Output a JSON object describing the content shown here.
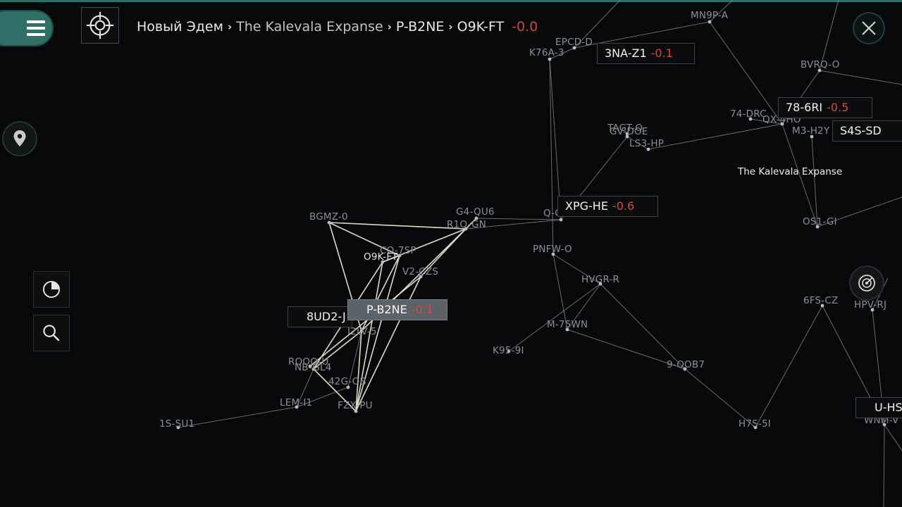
{
  "header": {
    "menu_icon": "hamburger-menu-icon",
    "target_icon": "crosshair-target-icon",
    "breadcrumb": [
      {
        "label": "Новый Эдем"
      },
      {
        "label": "The Kalevala Expanse"
      },
      {
        "label": "P-B2NE"
      },
      {
        "label": "O9K-FT"
      }
    ],
    "security": "-0.0",
    "close_icon": "close-icon"
  },
  "side_controls": {
    "pin_icon": "location-pin-icon",
    "stats_icon": "pie-chart-icon",
    "search_icon": "search-icon",
    "radar_icon": "radar-icon"
  },
  "region_label": "The Kalevala Expanse",
  "tags": [
    {
      "id": "3na",
      "name": "3NA-Z1",
      "sec": "-0.1"
    },
    {
      "id": "78",
      "name": "78-6RI",
      "sec": "-0.5"
    },
    {
      "id": "s4s",
      "name": "S4S-SD",
      "sec": ""
    },
    {
      "id": "xpg",
      "name": "XPG-HE",
      "sec": "-0.6"
    },
    {
      "id": "8ud",
      "name": "8UD2-J",
      "sec": ""
    },
    {
      "id": "pb2",
      "name": "P-B2NE",
      "sec": "-0.1"
    },
    {
      "id": "uhs",
      "name": "U-HS",
      "sec": ""
    }
  ],
  "systems": [
    {
      "name": "MN9P-A"
    },
    {
      "name": "EPCD-D"
    },
    {
      "name": "K76A-3"
    },
    {
      "name": "BVRQ-O"
    },
    {
      "name": "74-DRC"
    },
    {
      "name": "QX-4HO"
    },
    {
      "name": "M3-H2Y"
    },
    {
      "name": "TAGT-O"
    },
    {
      "name": "GV-DOE"
    },
    {
      "name": "LS3-HP"
    },
    {
      "name": "OS1-GI"
    },
    {
      "name": "BGMZ-0"
    },
    {
      "name": "G4-QU6"
    },
    {
      "name": "R1O-GN"
    },
    {
      "name": "Q-CICB"
    },
    {
      "name": "PNFW-O"
    },
    {
      "name": "CO-7SP"
    },
    {
      "name": "O9K-FT"
    },
    {
      "name": "V2-CZS"
    },
    {
      "name": "HVGR-R"
    },
    {
      "name": "6FS-CZ"
    },
    {
      "name": "HPV-RJ"
    },
    {
      "name": "M-75WN"
    },
    {
      "name": "K95-9I"
    },
    {
      "name": "9-OOB7"
    },
    {
      "name": "RQOO-U"
    },
    {
      "name": "NB-GL4"
    },
    {
      "name": "42G-OB"
    },
    {
      "name": "LEM-I1"
    },
    {
      "name": "FZX-PU"
    },
    {
      "name": "1S-SU1"
    },
    {
      "name": "H7S-5I"
    },
    {
      "name": "WNM-V"
    },
    {
      "name": "I2LV-5"
    }
  ]
}
